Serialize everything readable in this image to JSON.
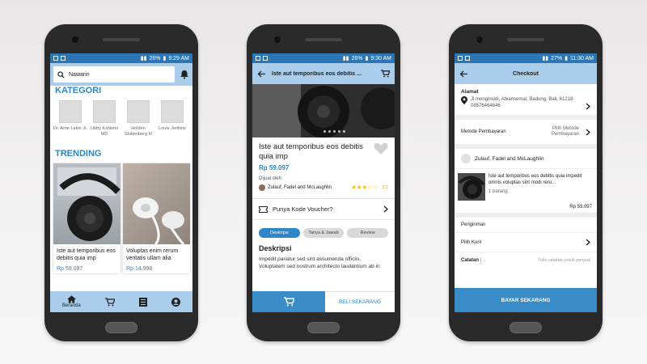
{
  "phones": [
    {
      "status": {
        "battery": "26%",
        "time": "9:29 AM"
      },
      "search": {
        "value": "Nawarin"
      },
      "kategori_title": "KATEGORI",
      "kategori": [
        {
          "name": "Dr. Arne Lakin Jr."
        },
        {
          "name": "Libby Kshlerin MD"
        },
        {
          "name": "Holden Stoltenberg III"
        },
        {
          "name": "Louie Jenkins"
        }
      ],
      "trending_title": "TRENDING",
      "products": [
        {
          "title": "Iste aut temporibus eos debitis quia imp",
          "price": "Rp 59.097"
        },
        {
          "title": "Voluptas enim rerum veritatis ullam alia",
          "price": "Rp 14.998"
        }
      ],
      "nav": {
        "home": "Beranda"
      }
    },
    {
      "status": {
        "battery": "26%",
        "time": "9:30 AM"
      },
      "appbar_title": "Iste aut temporibus eos debitis ...",
      "product_title": "Iste aut temporibus eos debitis quia imp",
      "price": "Rp 59.097",
      "sold_by_label": "Dijual oleh",
      "seller": "Zulauf, Fadel and McLaughlin",
      "rating": 3.2,
      "rating_text": "3.2",
      "voucher": "Punya Kode Voucher?",
      "tabs": [
        "Deskripsi",
        "Tanya & Jawab",
        "Review"
      ],
      "desc_title": "Deskripsi",
      "desc_text": "Impedit pariatur sed sint assumenda officiis. Voluptatem sed nostrum architecto laudantium ab in",
      "buy_label": "BELI SEKARANG"
    },
    {
      "status": {
        "battery": "27%",
        "time": "11:30 AM"
      },
      "appbar_title": "Checkout",
      "address_label": "Alamat",
      "address": "Jl monginsidi, Abiansemal, Badung, Bali, 61218",
      "phone": "08576464646",
      "payment_label": "Metode Pembayaran",
      "payment_value": "Pilih Metode Pembayaran",
      "store": "Zulauf, Fadel and McLaughlin",
      "item_title": "Iste aut temporibus eos debitis quia impedit omnis voluptas sint modi reru...",
      "item_qty": "1 barang",
      "item_price": "Rp 59.097",
      "shipping_label": "Pengiriman",
      "courier_label": "Pilih Kurir",
      "note_label": "Catatan :",
      "note_placeholder": "Tulis catatan untuk penjual",
      "pay_label": "BAYAR SEKARANG"
    }
  ],
  "colors": {
    "accent": "#2c86c8",
    "bar": "#a9cdea",
    "star": "#f1c40f"
  }
}
